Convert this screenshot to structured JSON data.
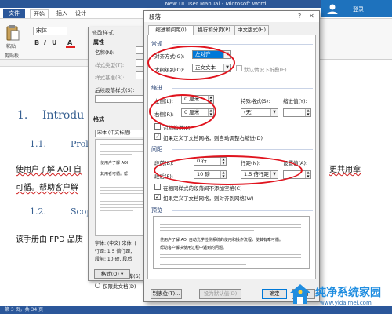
{
  "word": {
    "title": "New UI user Manual - Microsoft Word",
    "tabs": [
      "文件",
      "开始",
      "插入",
      "设计"
    ],
    "font_box": "宋体",
    "paste_label": "粘贴",
    "clipboard_label": "剪贴板",
    "signin": "登录"
  },
  "document": {
    "h1_num": "1.",
    "h1_text": "Introdu",
    "h2_num": "1.1.",
    "h2_text": "Prol",
    "body_line1_left": "使用户了解 AOI 自",
    "body_line1_right": "更共用章",
    "body_line2_left": "可循。帮助客户解",
    "h2b_num": "1.2.",
    "h2b_text": "Scop",
    "body_line3": "该手册由 FPD 品质",
    "status": "第 3 页，共 34 页"
  },
  "modify_style": {
    "title": "修改样式",
    "section_props": "属性",
    "name_label": "名称(N):",
    "type_label": "样式类型(T):",
    "based_label": "样式基准(B):",
    "next_label": "后续段落样式(S):",
    "section_format": "格式",
    "font_combo": "宋体 (中文标题)",
    "preview_line1": "使用户了解 AOI",
    "preview_line2": "其用者可循。帮",
    "desc1": "字体: (中文) 宋体, (",
    "desc2": "行距: 1.5 倍行距,",
    "desc3": "段前: 10 磅, 段后",
    "check1": "添加到样式库(S)",
    "radio1": "仅限此文档(D)",
    "format_button": "格式(O) ▾"
  },
  "paragraph": {
    "title": "段落",
    "help": "?",
    "close": "✕",
    "tabs": [
      "缩进和间距(I)",
      "换行和分页(P)",
      "中文版式(H)"
    ],
    "general": "常规",
    "alignment_label": "对齐方式(G):",
    "alignment_value": "左对齐",
    "outline_label": "大纲级别(O):",
    "outline_value": "正文文本",
    "collapse_label": "默认情况下折叠(E)",
    "indent": "缩进",
    "left_label": "左侧(L):",
    "left_value": "0 厘米",
    "right_label": "右侧(R):",
    "right_value": "0 厘米",
    "special_label": "特殊格式(S):",
    "special_value": "(无)",
    "indent_by_label": "缩进值(Y):",
    "mirror_label": "对称缩进(M)",
    "auto_indent_label": "如果定义了文档网格，则自动调整右缩进(D)",
    "spacing": "间距",
    "before_label": "段前(B):",
    "before_value": "0 行",
    "after_label": "段后(F):",
    "after_value": "10 磅",
    "line_label": "行距(N):",
    "line_value": "1.5 倍行距",
    "at_label": "设置值(A):",
    "no_space_label": "在相同样式的段落间不添加空格(C)",
    "snap_grid_label": "如果定义了文档网格，则对齐到网格(W)",
    "preview": "预览",
    "preview_text1": "使用户了解 AOI 自动光学检测系统的使用和操作流程，使其有章可循。",
    "preview_text2": "帮助客户解决使用过程中遇到的问题。",
    "tabs_button": "制表位(T)...",
    "default_button": "设为默认值(D)",
    "ok_button": "确定",
    "cancel_button": "取消"
  },
  "watermark": {
    "name": "纯净系统家园",
    "url": "www.yidaimei.com"
  },
  "colors": {
    "word_blue": "#2b579a",
    "heading_blue": "#365f91",
    "annotation_red": "#e0141e",
    "selection_blue": "#0078d7"
  }
}
